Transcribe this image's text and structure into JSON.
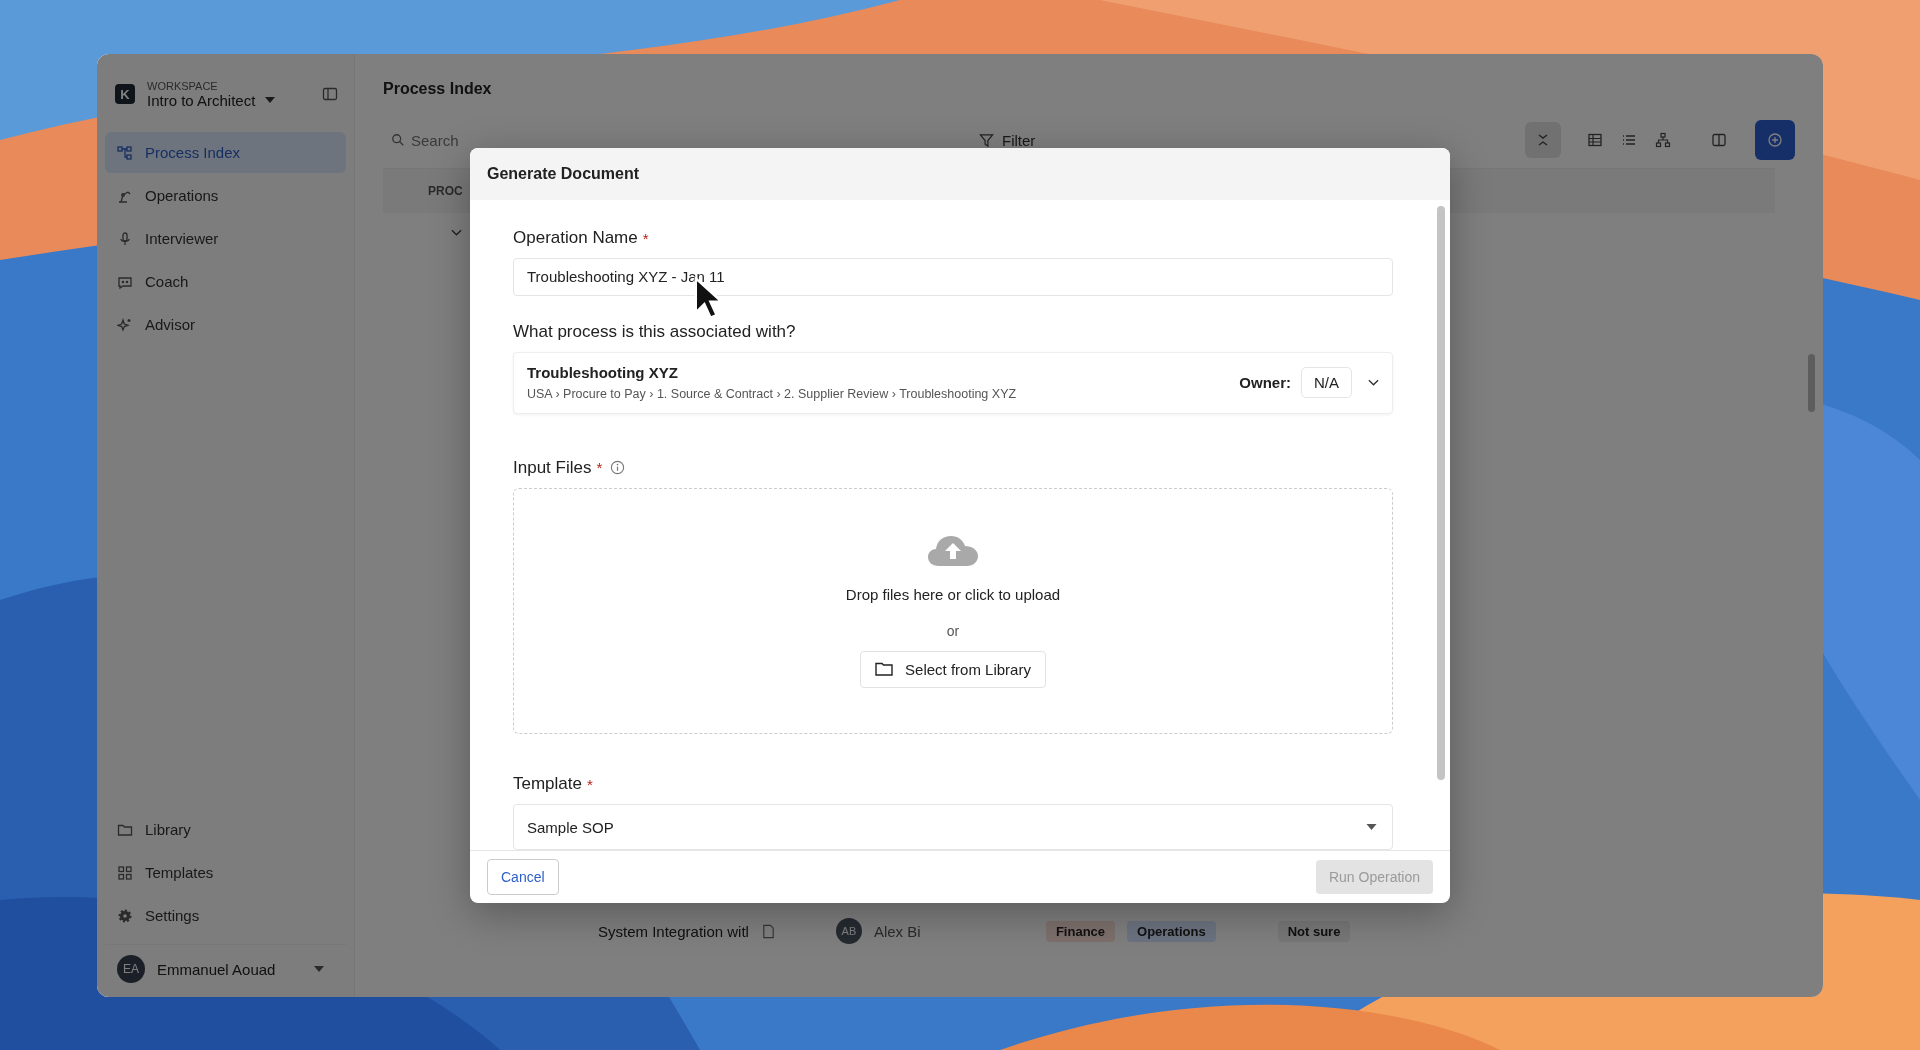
{
  "sidebar": {
    "workspace_label": "WORKSPACE",
    "logo": "K",
    "workspace": "Intro to Architect",
    "items": [
      {
        "label": "Process Index",
        "selected": true
      },
      {
        "label": "Operations",
        "selected": false
      },
      {
        "label": "Interviewer",
        "selected": false
      },
      {
        "label": "Coach",
        "selected": false
      },
      {
        "label": "Advisor",
        "selected": false
      }
    ],
    "bottom_items": [
      {
        "label": "Library",
        "selected": false
      },
      {
        "label": "Templates",
        "selected": false
      },
      {
        "label": "Settings",
        "selected": false
      }
    ],
    "user": {
      "initials": "EA",
      "name": "Emmanuel Aouad"
    }
  },
  "page": {
    "title": "Process Index",
    "search": {
      "placeholder": "Search"
    },
    "filter": "Filter",
    "table": {
      "column_1": "PROC",
      "row": {
        "name": "System Integration witl",
        "initials": "AB",
        "owner": "Alex Bi",
        "tags": [
          {
            "label": "Finance",
            "color": "#7d706c"
          },
          {
            "label": "Operations",
            "color": "#6c7380"
          }
        ],
        "status": "Not sure"
      }
    }
  },
  "dialog": {
    "title": "Generate Document",
    "operation_name": {
      "label": "Operation Name",
      "required_mark": "*",
      "value": "Troubleshooting XYZ - Jan 11"
    },
    "process": {
      "label": "What process is this associated with?",
      "name": "Troubleshooting XYZ",
      "path": "USA › Procure to Pay › 1. Source & Contract › 2. Supplier Review › Troubleshooting XYZ",
      "owner_label": "Owner:",
      "owner": "N/A"
    },
    "input_files": {
      "label": "Input Files",
      "required_mark": "*",
      "drop_text": "Drop files here or click to upload",
      "or": "or",
      "library_button": "Select from Library"
    },
    "template": {
      "label": "Template",
      "required_mark": "*",
      "value": "Sample SOP"
    },
    "cancel": "Cancel",
    "run": {
      "label": "Run Operation",
      "disabled": true
    }
  }
}
